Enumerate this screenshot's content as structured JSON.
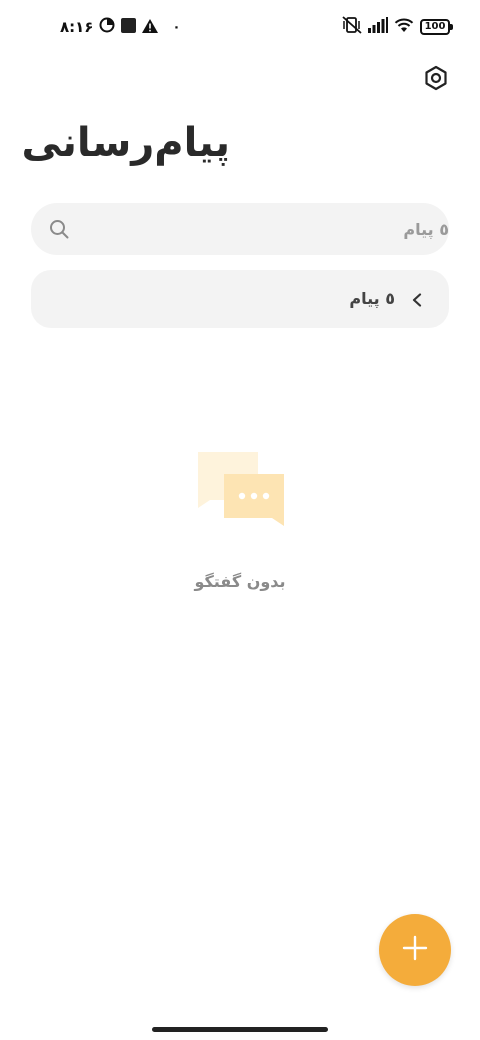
{
  "status_bar": {
    "time": "۸:۱۶",
    "notification_dot": "٠",
    "battery": "100"
  },
  "header": {
    "title": "پیام‌رسانی"
  },
  "search": {
    "placeholder": "٥ پیام"
  },
  "message_row": {
    "label": "٥ پیام"
  },
  "empty_state": {
    "text": "بدون گفتگو"
  },
  "colors": {
    "accent": "#f4ac3b",
    "background": "#ffffff",
    "surface": "#f3f3f3",
    "illustration": "#fde4b3"
  },
  "icons": {
    "settings": "gear-icon",
    "search": "search-icon",
    "chevron": "chevron-left-icon",
    "fab": "plus-icon"
  }
}
